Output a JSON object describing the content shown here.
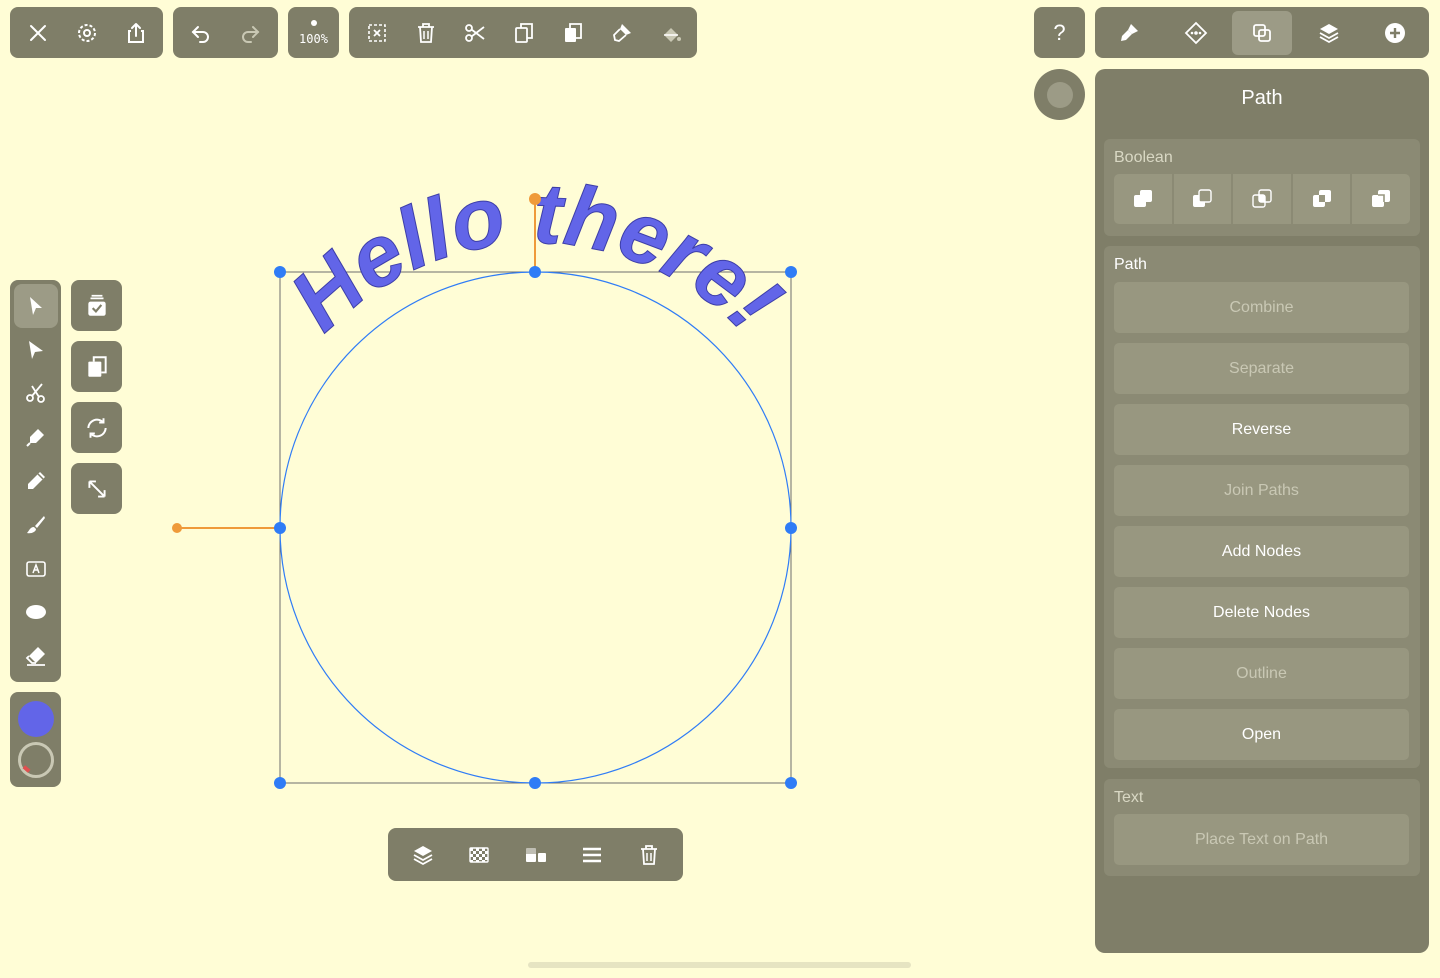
{
  "colors": {
    "background": "#fffdd6",
    "chrome": "#7f7e68",
    "text_fill": "#6265e8",
    "selection": "#2f7cf6",
    "handle_orange": "#ef9a3a"
  },
  "toolbar": {
    "zoom_label": "100%",
    "help_label": "?"
  },
  "canvas": {
    "text_on_path": "Hello there!"
  },
  "panel": {
    "title": "Path",
    "boolean": {
      "label": "Boolean",
      "ops": [
        "union-icon",
        "subtract-icon",
        "intersect-icon",
        "exclude-icon",
        "divide-icon"
      ]
    },
    "path": {
      "label": "Path",
      "buttons": [
        {
          "label": "Combine",
          "enabled": false
        },
        {
          "label": "Separate",
          "enabled": false
        },
        {
          "label": "Reverse",
          "enabled": true
        },
        {
          "label": "Join Paths",
          "enabled": false
        },
        {
          "label": "Add Nodes",
          "enabled": true
        },
        {
          "label": "Delete Nodes",
          "enabled": true
        },
        {
          "label": "Outline",
          "enabled": false
        },
        {
          "label": "Open",
          "enabled": true
        }
      ]
    },
    "text": {
      "label": "Text",
      "place_text_on_path": "Place Text on Path"
    }
  }
}
